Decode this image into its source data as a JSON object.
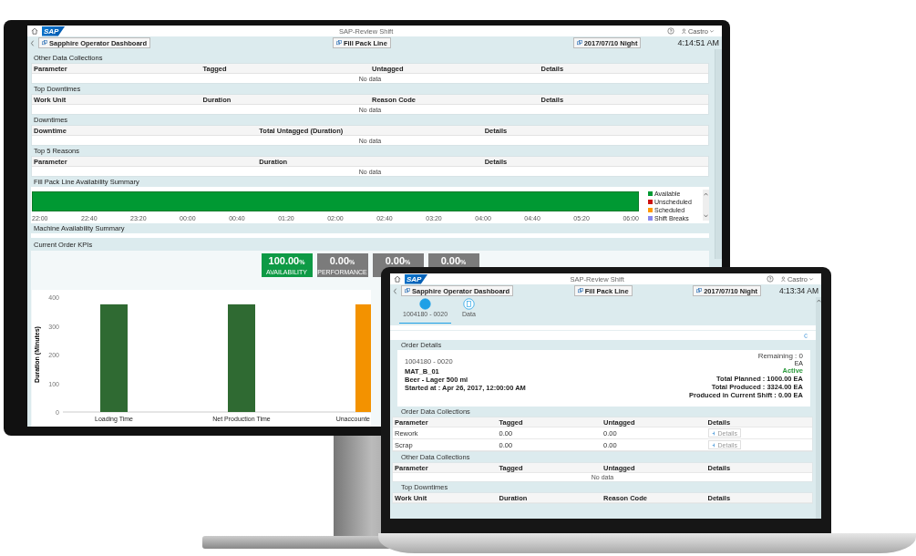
{
  "monitor": {
    "shell": {
      "logo": "SAP",
      "title": "SAP-Review Shift",
      "user": "Castro"
    },
    "nav": {
      "buttons": [
        "Sapphire Operator Dashboard",
        "Fill Pack Line",
        "2017/07/10 Night"
      ],
      "time": "4:14:51 AM"
    },
    "sections": [
      {
        "title": "Other Data Collections",
        "columns": [
          "Parameter",
          "Tagged",
          "Untagged",
          "Details"
        ],
        "empty": "No data"
      },
      {
        "title": "Top Downtimes",
        "columns": [
          "Work Unit",
          "Duration",
          "Reason Code",
          "Details"
        ],
        "empty": "No data"
      },
      {
        "title": "Downtimes",
        "columns": [
          "Downtime",
          "Total Untagged (Duration)",
          "Details"
        ],
        "empty": "No data"
      },
      {
        "title": "Top 5 Reasons",
        "columns": [
          "Parameter",
          "Duration",
          "Details"
        ],
        "empty": "No data"
      }
    ],
    "availability": {
      "title": "Fill Pack Line Availability Summary",
      "legend": [
        {
          "label": "Available",
          "color": "#009933"
        },
        {
          "label": "Unscheduled",
          "color": "#cc1111"
        },
        {
          "label": "Scheduled",
          "color": "#ff9900"
        },
        {
          "label": "Shift Breaks",
          "color": "#8888ee"
        }
      ],
      "ticks": [
        "22:00",
        "22:40",
        "23:20",
        "00:00",
        "00:40",
        "01:20",
        "02:00",
        "02:40",
        "03:20",
        "04:00",
        "04:40",
        "05:20",
        "06:00"
      ]
    },
    "machine": {
      "title": "Machine Availability Summary"
    },
    "kpis": {
      "title": "Current Order KPIs",
      "tiles": [
        {
          "value": "100.00",
          "unit": "%",
          "label": "AVAILABILITY",
          "color": "#0e9a45"
        },
        {
          "value": "0.00",
          "unit": "%",
          "label": "PERFORMANCE",
          "color": "#7b7b7b"
        },
        {
          "value": "0.00",
          "unit": "%",
          "color": "#7b7b7b"
        },
        {
          "value": "0.00",
          "unit": "%",
          "color": "#7b7b7b"
        }
      ],
      "chart_data": {
        "type": "bar",
        "ylabel": "Duration (Minutes)",
        "categories": [
          "Loading Time",
          "Net Production Time",
          "Unaccounte"
        ],
        "ylim": [
          0,
          400
        ],
        "yticks": [
          0,
          100,
          200,
          300,
          400
        ],
        "stacked": true,
        "series": [
          {
            "color": "#2f6a32",
            "values": [
              375,
              375,
              null
            ]
          },
          {
            "color": "#f39200",
            "values": [
              null,
              null,
              375
            ]
          }
        ]
      }
    }
  },
  "laptop": {
    "shell": {
      "logo": "SAP",
      "title": "SAP-Review Shift",
      "user": "Castro"
    },
    "nav": {
      "buttons": [
        "Sapphire Operator Dashboard",
        "Fill Pack Line",
        "2017/07/10 Night"
      ],
      "time": "4:13:34 AM"
    },
    "tabs": [
      {
        "label": "1004180 - 0020",
        "selected": true
      },
      {
        "label": "Data",
        "selected": false
      }
    ],
    "order": {
      "title": "Order Details",
      "id": "1004180 - 0020",
      "material": "MAT_B_01",
      "description": "Beer - Lager 500 ml",
      "started": "Started at : Apr 26, 2017, 12:00:00 AM",
      "remaining": "Remaining : 0",
      "remaining_unit": "EA",
      "status": "Active",
      "planned": "Total Planned : 1000.00 EA",
      "produced": "Total Produced : 3324.00 EA",
      "shift": "Produced in Current Shift : 0.00 EA"
    },
    "order_data": {
      "title": "Order Data Collections",
      "columns": [
        "Parameter",
        "Tagged",
        "Untagged",
        "Details"
      ],
      "rows": [
        {
          "cells": [
            "Rework",
            "0.00",
            "0.00"
          ],
          "button": "Details",
          "disabled": true
        },
        {
          "cells": [
            "Scrap",
            "0.00",
            "0.00"
          ],
          "button": "Details",
          "disabled": true
        }
      ]
    },
    "other": {
      "title": "Other Data Collections",
      "columns": [
        "Parameter",
        "Tagged",
        "Untagged",
        "Details"
      ],
      "empty": "No data"
    },
    "downtimes": {
      "title": "Top Downtimes",
      "columns": [
        "Work Unit",
        "Duration",
        "Reason Code",
        "Details"
      ]
    }
  }
}
